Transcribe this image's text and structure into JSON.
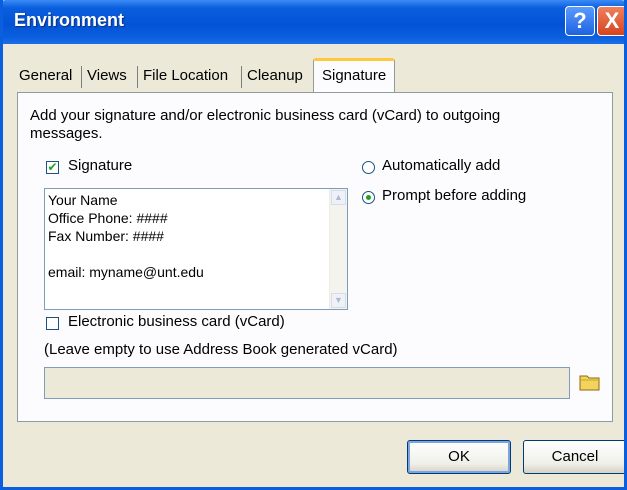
{
  "window": {
    "title": "Environment",
    "help_button": "?",
    "close_button": "X"
  },
  "tabs": [
    {
      "label": "General",
      "active": false
    },
    {
      "label": "Views",
      "active": false
    },
    {
      "label": "File Location",
      "active": false
    },
    {
      "label": "Cleanup",
      "active": false
    },
    {
      "label": "Signature",
      "active": true
    }
  ],
  "signature_tab": {
    "description_line1": "Add your signature and/or electronic business card (vCard) to outgoing",
    "description_line2": "messages.",
    "signature_checkbox": {
      "label": "Signature",
      "checked": true
    },
    "signature_text": [
      "Your Name",
      "Office Phone: ####",
      "Fax Number: ####",
      "",
      "email: myname@unt.edu"
    ],
    "add_mode": {
      "options": [
        {
          "label": "Automatically add",
          "selected": false
        },
        {
          "label": "Prompt before adding",
          "selected": true
        }
      ]
    },
    "vcard_checkbox": {
      "label": "Electronic business card (vCard)",
      "checked": false
    },
    "vcard_hint": "(Leave empty to use Address Book generated vCard)",
    "vcard_path": ""
  },
  "buttons": {
    "ok": "OK",
    "cancel": "Cancel"
  },
  "colors": {
    "titlebar": "#0a5fde",
    "dialog_bg": "#ece9d8",
    "check_green": "#21a121",
    "active_tab_accent": "#ffc83c"
  }
}
